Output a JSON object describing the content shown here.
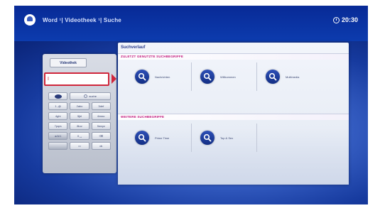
{
  "header": {
    "breadcrumb": "Word ¹| Videotheek ¹| Suche",
    "time": "20:30"
  },
  "keyboard": {
    "tab_label": "Videothek",
    "input_value": "I",
    "keys": [
      {
        "label": "",
        "icon": "eye-icon"
      },
      {
        "label": "suche",
        "icon": "search-icon"
      },
      {
        "label": "1.,@"
      },
      {
        "label": "2abc"
      },
      {
        "label": "3def"
      },
      {
        "label": "4ghi"
      },
      {
        "label": "5jkl"
      },
      {
        "label": "6mno"
      },
      {
        "label": "7pqrs"
      },
      {
        "label": "8tuv"
      },
      {
        "label": "9wxyz"
      },
      {
        "label": "a/A/1"
      },
      {
        "label": "0 ␣"
      },
      {
        "label": "⌫"
      },
      {
        "label": ""
      },
      {
        "label": "▭"
      },
      {
        "label": "ok"
      }
    ]
  },
  "main": {
    "title": "Suchverlauf",
    "section_recent": "ZULETZT GENUTZTE SUCHBEGRIFFE",
    "recent_items": [
      "Nachrichten",
      "Willkommen",
      "Multimedia"
    ],
    "section_other": "WEITERE SUCHBEGRIFFE",
    "other_items": [
      "Prime Time",
      "Top & Sex"
    ]
  },
  "colors": {
    "accent_red": "#d0263b",
    "section_magenta": "#c2167a",
    "tv_blue": "#0a2a8e"
  }
}
